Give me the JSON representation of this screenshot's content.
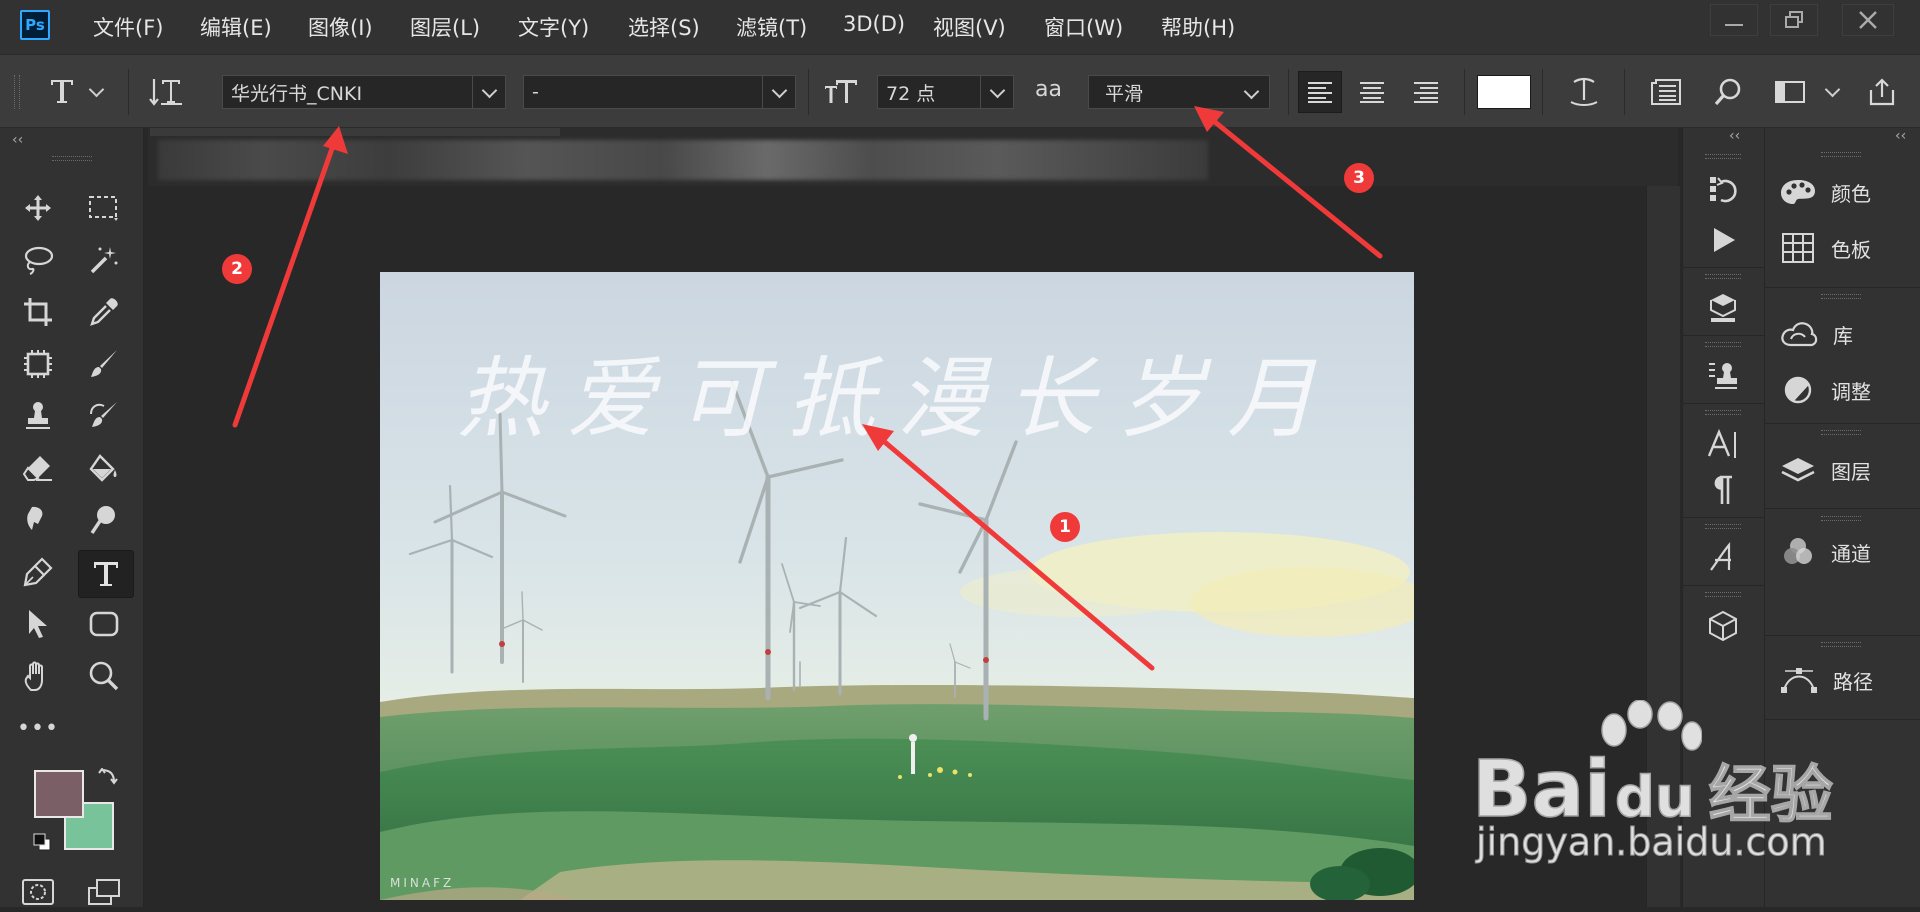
{
  "app": {
    "logo": "Ps",
    "menu": [
      "文件(F)",
      "编辑(E)",
      "图像(I)",
      "图层(L)",
      "文字(Y)",
      "选择(S)",
      "滤镜(T)",
      "3D(D)",
      "视图(V)",
      "窗口(W)",
      "帮助(H)"
    ]
  },
  "options": {
    "font_family": "华光行书_CNKI",
    "font_style": "-",
    "font_size": "72 点",
    "antialias": "平滑",
    "antialias_label": "aa"
  },
  "document": {
    "artwork_text": "热爱可抵漫长岁月",
    "signature": "MINAFZ"
  },
  "annotations": {
    "badge1": "1",
    "badge2": "2",
    "badge3": "3",
    "color": "#f03a3a"
  },
  "colors": {
    "foreground": "#7a5f66",
    "background": "#79c39a",
    "text_color_swatch": "#ffffff",
    "accent": "#31a8ff"
  },
  "panels": {
    "items": [
      {
        "label": "颜色",
        "icon": "palette-icon"
      },
      {
        "label": "色板",
        "icon": "swatches-grid-icon"
      },
      {
        "label": "库",
        "icon": "cc-libraries-icon"
      },
      {
        "label": "调整",
        "icon": "adjustments-icon"
      },
      {
        "label": "图层",
        "icon": "layers-icon"
      },
      {
        "label": "通道",
        "icon": "channels-icon"
      },
      {
        "label": "路径",
        "icon": "paths-icon"
      }
    ]
  },
  "watermark": {
    "brand_latin": "Bai",
    "brand_du": "du",
    "brand_cn": "经验",
    "url": "jingyan.baidu.com"
  }
}
